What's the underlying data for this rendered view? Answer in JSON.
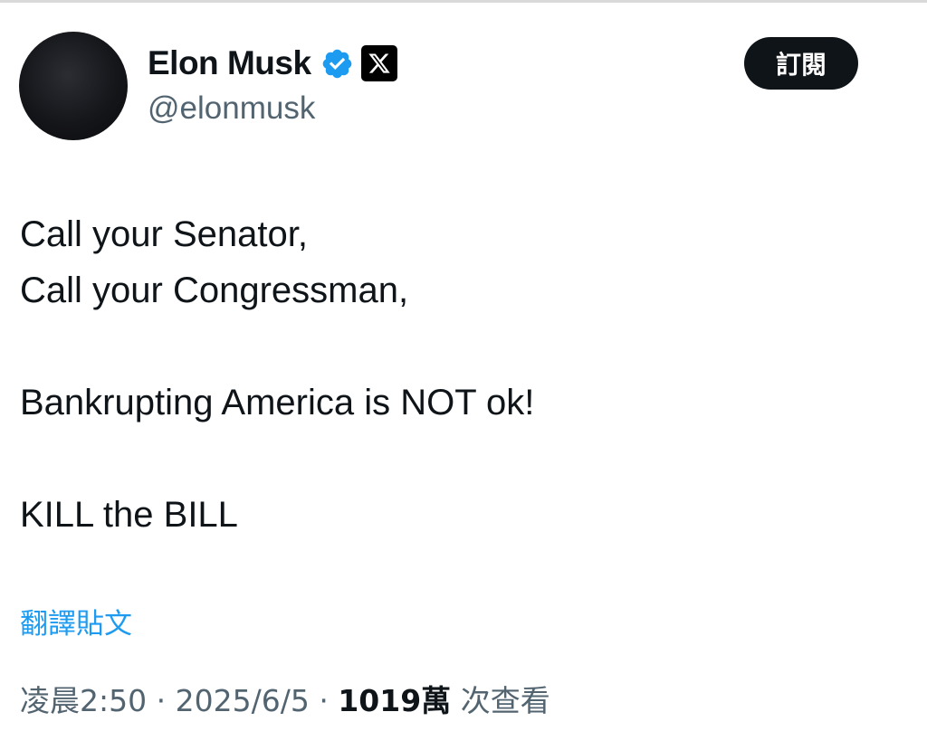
{
  "author": {
    "display_name": "Elon Musk",
    "handle": "@elonmusk",
    "verified_icon": "verified-badge-icon",
    "affiliate_icon": "x-logo-icon",
    "verified_color": "#1d9bf0"
  },
  "subscribe_button": {
    "label": "訂閱"
  },
  "tweet": {
    "lines": [
      "Call your Senator,",
      "Call your Congressman,",
      "",
      "Bankrupting America is NOT ok!",
      "",
      "KILL the BILL"
    ]
  },
  "translate_link": {
    "label": "翻譯貼文"
  },
  "meta": {
    "time": "凌晨2:50",
    "separator": "·",
    "date": "2025/6/5",
    "views_count": "1019萬",
    "views_label": "次查看"
  }
}
